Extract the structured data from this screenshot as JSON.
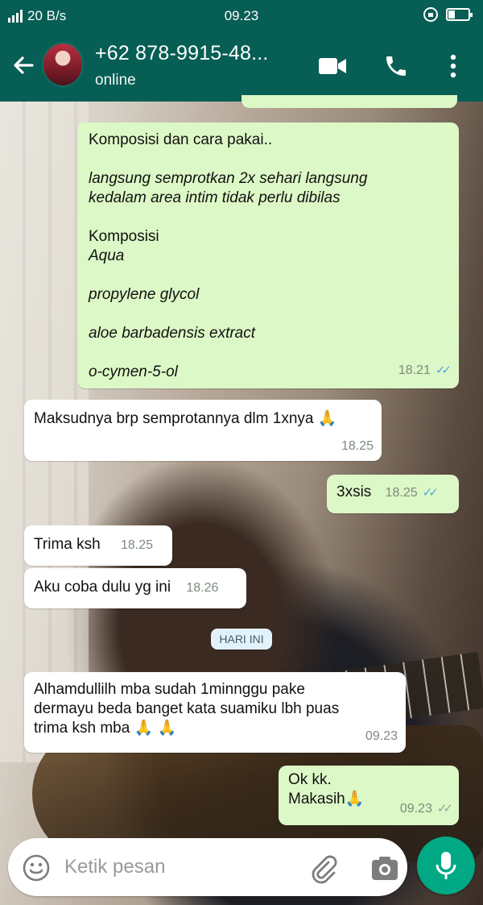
{
  "statusbar": {
    "network": "20 B/s",
    "time": "09.23"
  },
  "header": {
    "contact_name": "+62 878-9915-48...",
    "status": "online"
  },
  "messages": [
    {
      "direction": "out",
      "lines": [
        "Komposisi dan cara pakai..",
        "",
        "langsung semprotkan 2x sehari langsung",
        "kedalam area intim tidak perlu dibilas",
        "",
        "Komposisi",
        "Aqua",
        "",
        "propylene glycol",
        "",
        "aloe barbadensis extract",
        "",
        "o-cymen-5-ol"
      ],
      "time": "18.21",
      "read": true
    },
    {
      "direction": "in",
      "text": "Maksudnya brp semprotannya dlm 1xnya 🙏",
      "time": "18.25"
    },
    {
      "direction": "out",
      "text": "3xsis",
      "time": "18.25",
      "read": true
    },
    {
      "direction": "in",
      "text": "Trima ksh",
      "time": "18.25"
    },
    {
      "direction": "in",
      "text": "Aku coba dulu yg ini",
      "time": "18.26"
    },
    {
      "direction": "in",
      "lines": [
        "Alhamdullilh mba sudah 1minnggu pake",
        "dermayu beda banget kata suamiku lbh puas",
        "trima ksh mba 🙏 🙏"
      ],
      "time": "09.23"
    },
    {
      "direction": "out",
      "lines": [
        "Ok kk.",
        "Makasih🙏"
      ],
      "time": "09.23",
      "read": false
    }
  ],
  "day_separator": "HARI INI",
  "input": {
    "placeholder": "Ketik pesan"
  },
  "colors": {
    "header": "#075e54",
    "outgoing_bubble": "#dcf8c6",
    "incoming_bubble": "#ffffff",
    "read_ticks": "#4fa8e0",
    "mic_button": "#00a884"
  },
  "icons": [
    "back-arrow-icon",
    "video-call-icon",
    "phone-icon",
    "more-vert-icon",
    "emoji-icon",
    "attach-icon",
    "camera-icon",
    "mic-icon"
  ]
}
